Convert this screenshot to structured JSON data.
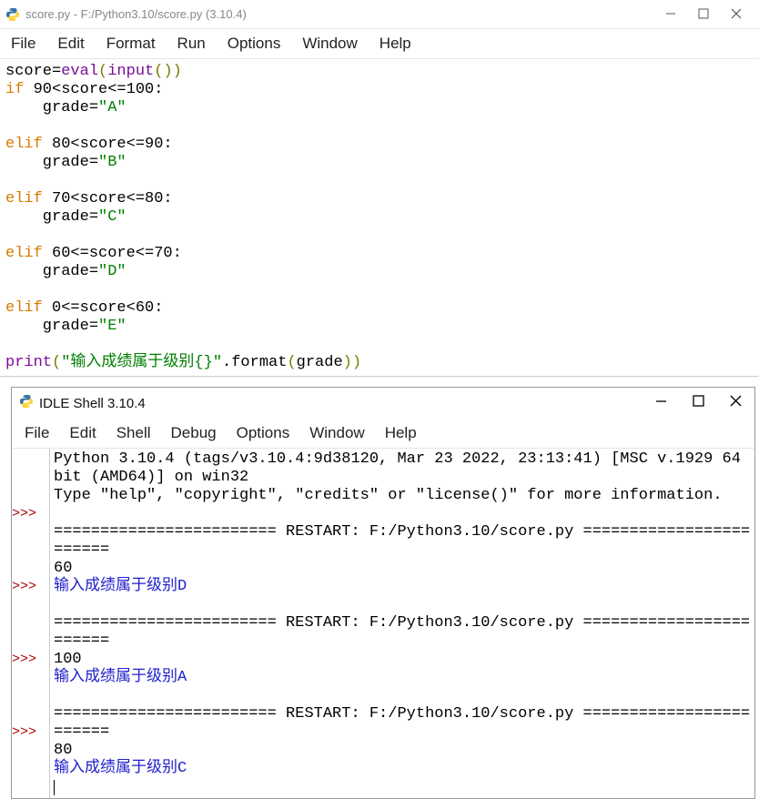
{
  "editor": {
    "title": "score.py - F:/Python3.10/score.py (3.10.4)",
    "menu": [
      "File",
      "Edit",
      "Format",
      "Run",
      "Options",
      "Window",
      "Help"
    ],
    "code": {
      "l1a": "score=",
      "l1b": "eval",
      "l1c": "(",
      "l1d": "input",
      "l1e": "())",
      "l2a": "if",
      "l2b": " 90<score<=100:",
      "l3a": "    grade=",
      "l3b": "\"A\"",
      "l4": "",
      "l5a": "elif",
      "l5b": " 80<score<=90:",
      "l6a": "    grade=",
      "l6b": "\"B\"",
      "l7": "",
      "l8a": "elif",
      "l8b": " 70<score<=80:",
      "l9a": "    grade=",
      "l9b": "\"C\"",
      "l10": "",
      "l11a": "elif",
      "l11b": " 60<=score<=70:",
      "l12a": "    grade=",
      "l12b": "\"D\"",
      "l13": "",
      "l14a": "elif",
      "l14b": " 0<=score<60:",
      "l15a": "    grade=",
      "l15b": "\"E\"",
      "l16": "",
      "l17a": "print",
      "l17b": "(",
      "l17c": "\"输入成绩属于级别{}\"",
      "l17d": ".format",
      "l17e": "(",
      "l17f": "grade",
      "l17g": "))"
    }
  },
  "shell": {
    "title": "IDLE Shell 3.10.4",
    "menu": [
      "File",
      "Edit",
      "Shell",
      "Debug",
      "Options",
      "Window",
      "Help"
    ],
    "prompt": ">>>",
    "banner1": "Python 3.10.4 (tags/v3.10.4:9d38120, Mar 23 2022, 23:13:41) [MSC v.1929 64 bit (AMD64)] on win32",
    "banner2": "Type \"help\", \"copyright\", \"credits\" or \"license()\" for more information.",
    "restart": "======================== RESTART: F:/Python3.10/score.py ========================",
    "run1_in": "60",
    "run1_out": "输入成绩属于级别D",
    "run2_in": "100",
    "run2_out": "输入成绩属于级别A",
    "run3_in": "80",
    "run3_out": "输入成绩属于级别C"
  }
}
